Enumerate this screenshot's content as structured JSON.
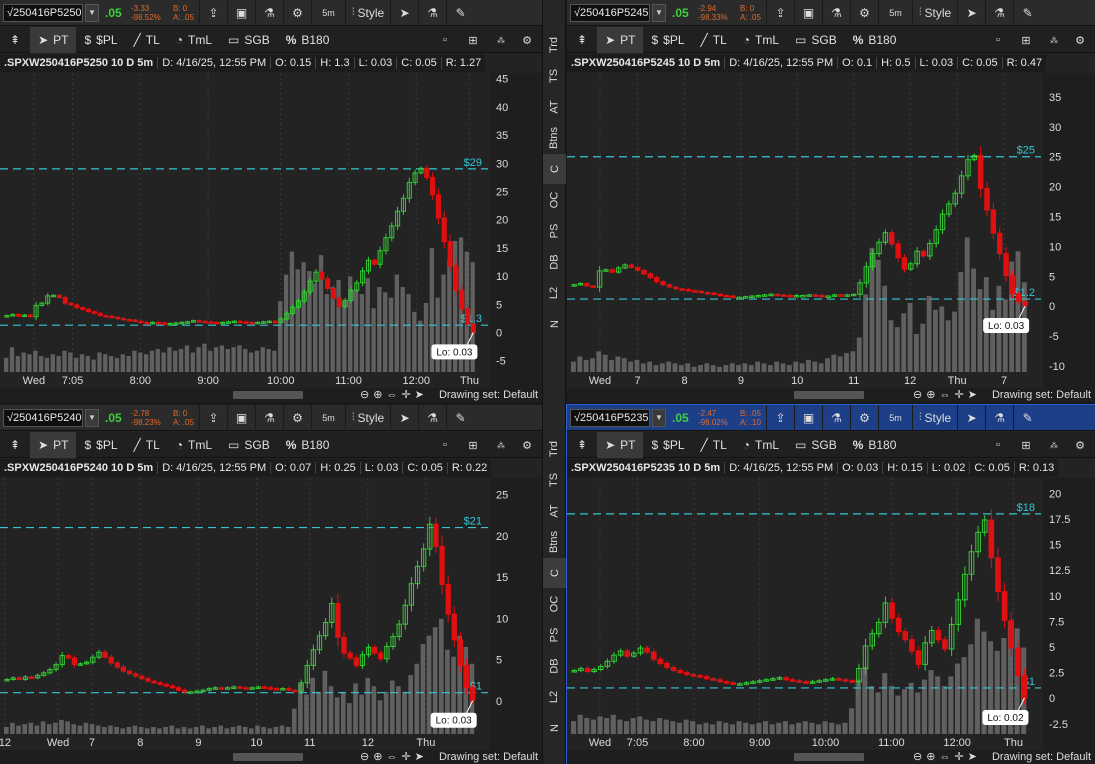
{
  "side_tabs": [
    "Trd",
    "TS",
    "AT",
    "Btns",
    "C",
    "OC",
    "PS",
    "DB",
    "L2",
    "N"
  ],
  "toolbar": {
    "style_label": "Style",
    "timeframe_label": "5m",
    "pt_label": "PT",
    "pl_label": "$PL",
    "tl_label": "TL",
    "tml_label": "TmL",
    "sgb_label": "SGB",
    "b180_label": "B180",
    "drawing_set": "Drawing set: Default"
  },
  "colors": {
    "up": "#33cc33",
    "down": "#e01010",
    "level": "#35c6d6",
    "volume": "#6b6b6b",
    "active_header": "#1d3f87"
  },
  "panels": [
    {
      "id": "p5250",
      "symbol_short": "√250416P5250",
      "last": ".05",
      "change": "-3.33",
      "change_pct": "-98.52%",
      "bid": "B: 0",
      "ask": "A: .05",
      "active": false,
      "info": {
        "symbol": ".SPXW250416P5250 10 D 5m",
        "date": "D: 4/16/25, 12:55 PM",
        "open": "O: 0.15",
        "high": "H: 1.3",
        "low": "L: 0.03",
        "close": "C: 0.05",
        "range": "R: 1.27"
      },
      "lo_label": "Lo: 0.03",
      "x_labels": [
        {
          "t": "Wed",
          "p": 0.07
        },
        {
          "t": "7:05",
          "p": 0.15
        },
        {
          "t": "8:00",
          "p": 0.29
        },
        {
          "t": "9:00",
          "p": 0.43
        },
        {
          "t": "10:00",
          "p": 0.58
        },
        {
          "t": "11:00",
          "p": 0.72
        },
        {
          "t": "12:00",
          "p": 0.86
        },
        {
          "t": "Thu",
          "p": 0.97
        }
      ],
      "chart_data": {
        "type": "candlestick",
        "ylim": [
          -7,
          46
        ],
        "y_ticks": [
          45,
          40,
          35,
          30,
          25,
          20,
          15,
          10,
          5,
          0,
          -5
        ],
        "levels": [
          {
            "value": 29,
            "label": "$29"
          },
          {
            "value": 1.3,
            "label": "$1.3"
          }
        ],
        "low_value": 0.03,
        "closes": [
          3,
          3.2,
          2.9,
          3.1,
          2.8,
          4.8,
          5.2,
          6.5,
          6.6,
          6.2,
          5.2,
          4.9,
          4.4,
          4.1,
          3.7,
          3.4,
          3.0,
          2.9,
          2.7,
          2.5,
          2.3,
          2.2,
          2.0,
          1.8,
          1.7,
          1.8,
          1.7,
          1.5,
          1.6,
          1.7,
          1.8,
          1.9,
          2.1,
          2.0,
          1.9,
          1.8,
          1.7,
          1.8,
          1.9,
          2.0,
          1.9,
          1.8,
          1.7,
          1.8,
          1.9,
          2.0,
          1.8,
          2.4,
          3.4,
          4.5,
          5.6,
          7.2,
          9.1,
          10.7,
          9.5,
          7.8,
          6.1,
          4.6,
          5.7,
          7.5,
          8.8,
          10.9,
          12.8,
          12.1,
          14.5,
          16.8,
          18.9,
          21.5,
          23.8,
          26.6,
          28.3,
          29.1,
          27.5,
          24.4,
          20.3,
          16.1,
          11.8,
          7.5,
          4.2,
          1.5,
          0.05
        ],
        "volumes": [
          8,
          14,
          9,
          11,
          10,
          12,
          9,
          8,
          10,
          9,
          12,
          11,
          8,
          10,
          9,
          7,
          11,
          10,
          9,
          8,
          10,
          9,
          12,
          11,
          10,
          12,
          13,
          11,
          14,
          12,
          13,
          15,
          11,
          14,
          16,
          12,
          14,
          15,
          13,
          14,
          15,
          13,
          11,
          12,
          14,
          13,
          12,
          40,
          55,
          68,
          58,
          62,
          57,
          50,
          66,
          44,
          48,
          52,
          40,
          54,
          46,
          44,
          53,
          36,
          48,
          45,
          42,
          55,
          48,
          44,
          34,
          29,
          39,
          70,
          42,
          55,
          64,
          74,
          76,
          68,
          62
        ]
      }
    },
    {
      "id": "p5245",
      "symbol_short": "√250416P5245",
      "last": ".05",
      "change": "-2.94",
      "change_pct": "-98.33%",
      "bid": "B: 0",
      "ask": "A: .05",
      "active": false,
      "info": {
        "symbol": ".SPXW250416P5245 10 D 5m",
        "date": "D: 4/16/25, 12:55 PM",
        "open": "O: 0.1",
        "high": "H: 0.5",
        "low": "L: 0.03",
        "close": "C: 0.05",
        "range": "R: 0.47"
      },
      "lo_label": "Lo: 0.03",
      "x_labels": [
        {
          "t": "Wed",
          "p": 0.07
        },
        {
          "t": "7",
          "p": 0.15
        },
        {
          "t": "8",
          "p": 0.25
        },
        {
          "t": "9",
          "p": 0.37
        },
        {
          "t": "10",
          "p": 0.49
        },
        {
          "t": "11",
          "p": 0.61
        },
        {
          "t": "12",
          "p": 0.73
        },
        {
          "t": "Thu",
          "p": 0.83
        },
        {
          "t": "7",
          "p": 0.93
        }
      ],
      "chart_data": {
        "type": "candlestick",
        "ylim": [
          -11,
          39
        ],
        "y_ticks": [
          35,
          30,
          25,
          20,
          15,
          10,
          5,
          0,
          -5,
          -10
        ],
        "levels": [
          {
            "value": 25,
            "label": "$25"
          },
          {
            "value": 1.2,
            "label": "$1.2"
          }
        ],
        "low_value": 0.03,
        "closes": [
          3.6,
          3.8,
          3.4,
          3.2,
          5.9,
          6.1,
          5.7,
          6.4,
          6.9,
          6.5,
          6.0,
          5.4,
          4.8,
          4.1,
          3.6,
          3.2,
          2.9,
          2.8,
          2.6,
          2.5,
          2.3,
          2.2,
          2.0,
          1.8,
          1.7,
          1.5,
          1.5,
          1.6,
          1.7,
          1.8,
          1.9,
          2.0,
          1.9,
          1.8,
          1.7,
          1.8,
          1.8,
          1.9,
          1.8,
          1.7,
          1.7,
          1.9,
          1.8,
          1.9,
          2.0,
          3.9,
          6.6,
          8.8,
          10.7,
          12.3,
          10.4,
          8.1,
          6.2,
          7.1,
          9.2,
          8.4,
          10.5,
          12.8,
          15.4,
          17.1,
          18.9,
          21.8,
          24.5,
          25.2,
          19.7,
          16.1,
          12.2,
          8.8,
          5.1,
          2.1,
          0.8,
          0.05
        ],
        "volumes": [
          6,
          9,
          7,
          8,
          12,
          10,
          7,
          9,
          8,
          6,
          7,
          5,
          6,
          4,
          5,
          6,
          5,
          4,
          5,
          3,
          4,
          5,
          4,
          3,
          4,
          5,
          4,
          5,
          4,
          6,
          5,
          4,
          6,
          5,
          4,
          6,
          5,
          7,
          6,
          5,
          8,
          10,
          9,
          11,
          12,
          20,
          45,
          72,
          65,
          50,
          30,
          26,
          34,
          40,
          22,
          28,
          44,
          36,
          38,
          30,
          35,
          58,
          78,
          60,
          48,
          55,
          36,
          50,
          42,
          64,
          70,
          52
        ]
      }
    },
    {
      "id": "p5240",
      "symbol_short": "√250416P5240",
      "last": ".05",
      "change": "-2.78",
      "change_pct": "-98.23%",
      "bid": "B: 0",
      "ask": "A: .05",
      "active": false,
      "info": {
        "symbol": ".SPXW250416P5240 10 D 5m",
        "date": "D: 4/16/25, 12:55 PM",
        "open": "O: 0.07",
        "high": "H: 0.25",
        "low": "L: 0.03",
        "close": "C: 0.05",
        "range": "R: 0.22"
      },
      "lo_label": "Lo: 0.03",
      "x_labels": [
        {
          "t": "12",
          "p": 0.01
        },
        {
          "t": "Wed",
          "p": 0.12
        },
        {
          "t": "7",
          "p": 0.19
        },
        {
          "t": "8",
          "p": 0.29
        },
        {
          "t": "9",
          "p": 0.41
        },
        {
          "t": "10",
          "p": 0.53
        },
        {
          "t": "11",
          "p": 0.64
        },
        {
          "t": "12",
          "p": 0.76
        },
        {
          "t": "Thu",
          "p": 0.88
        }
      ],
      "chart_data": {
        "type": "candlestick",
        "ylim": [
          -4,
          27
        ],
        "y_ticks": [
          25,
          20,
          15,
          10,
          5,
          0
        ],
        "levels": [
          {
            "value": 21,
            "label": "$21"
          },
          {
            "value": 1,
            "label": "$1"
          }
        ],
        "low_value": 0.03,
        "closes": [
          2.6,
          2.8,
          2.6,
          2.9,
          2.8,
          3.1,
          3.4,
          3.8,
          4.4,
          5.5,
          5.2,
          4.4,
          4.5,
          4.7,
          5.3,
          5.9,
          5.3,
          4.6,
          4.1,
          3.6,
          3.3,
          3.0,
          2.7,
          2.4,
          2.2,
          2.0,
          1.8,
          1.6,
          1.3,
          1.1,
          1.1,
          1.2,
          1.3,
          1.5,
          1.6,
          1.5,
          1.6,
          1.7,
          1.6,
          1.5,
          1.6,
          1.7,
          1.6,
          1.5,
          1.4,
          1.5,
          1.3,
          1.2,
          2.2,
          4.3,
          6.2,
          7.9,
          9.5,
          11.8,
          7.7,
          5.8,
          5.2,
          4.3,
          5.6,
          6.5,
          5.8,
          5.1,
          6.6,
          7.8,
          9.3,
          11.6,
          14.2,
          16.3,
          18.4,
          21.4,
          18.7,
          14.1,
          10.5,
          7.4,
          4.3,
          1.6,
          0.05
        ],
        "volumes": [
          5,
          8,
          6,
          7,
          8,
          6,
          9,
          7,
          8,
          10,
          9,
          7,
          6,
          8,
          7,
          6,
          5,
          6,
          5,
          4,
          5,
          6,
          5,
          4,
          5,
          4,
          5,
          6,
          4,
          5,
          4,
          5,
          6,
          4,
          5,
          6,
          4,
          5,
          6,
          5,
          4,
          6,
          5,
          4,
          5,
          6,
          5,
          18,
          36,
          28,
          40,
          30,
          45,
          34,
          26,
          30,
          22,
          36,
          28,
          40,
          34,
          24,
          30,
          38,
          34,
          30,
          42,
          50,
          64,
          70,
          76,
          82,
          60,
          55,
          70,
          62,
          50
        ]
      }
    },
    {
      "id": "p5235",
      "symbol_short": "√250416P5235",
      "last": ".05",
      "change": "-2.47",
      "change_pct": "-98.02%",
      "bid": "B: .05",
      "ask": "A: .10",
      "active": true,
      "info": {
        "symbol": ".SPXW250416P5235 10 D 5m",
        "date": "D: 4/16/25, 12:55 PM",
        "open": "O: 0.03",
        "high": "H: 0.15",
        "low": "L: 0.02",
        "close": "C: 0.05",
        "range": "R: 0.13"
      },
      "lo_label": "Lo: 0.02",
      "x_labels": [
        {
          "t": "Wed",
          "p": 0.07
        },
        {
          "t": "7:05",
          "p": 0.15
        },
        {
          "t": "8:00",
          "p": 0.27
        },
        {
          "t": "9:00",
          "p": 0.41
        },
        {
          "t": "10:00",
          "p": 0.55
        },
        {
          "t": "11:00",
          "p": 0.69
        },
        {
          "t": "12:00",
          "p": 0.83
        },
        {
          "t": "Thu",
          "p": 0.95
        }
      ],
      "chart_data": {
        "type": "candlestick",
        "ylim": [
          -3.5,
          21.5
        ],
        "y_ticks": [
          20,
          17.5,
          15,
          12.5,
          10,
          7.5,
          5,
          2.5,
          0,
          -2.5
        ],
        "levels": [
          {
            "value": 18,
            "label": "$18"
          },
          {
            "value": 1,
            "label": "$1"
          }
        ],
        "low_value": 0.02,
        "closes": [
          2.7,
          2.9,
          2.6,
          2.8,
          3.1,
          3.6,
          4.2,
          4.6,
          4.1,
          4.4,
          4.9,
          4.5,
          3.8,
          3.4,
          3.0,
          2.7,
          2.5,
          2.3,
          2.2,
          2.1,
          1.9,
          1.8,
          1.6,
          1.5,
          1.4,
          1.4,
          1.5,
          1.6,
          1.7,
          1.8,
          1.9,
          2.0,
          1.8,
          1.7,
          1.6,
          1.5,
          1.6,
          1.7,
          1.8,
          1.9,
          1.8,
          1.7,
          1.6,
          2.9,
          5.1,
          6.3,
          7.4,
          9.3,
          7.8,
          6.5,
          5.7,
          4.6,
          3.3,
          5.4,
          6.6,
          5.7,
          4.8,
          7.2,
          9.6,
          12.1,
          14.3,
          16.2,
          17.4,
          13.7,
          10.4,
          7.6,
          4.9,
          2.2,
          0.02
        ],
        "volumes": [
          8,
          12,
          10,
          9,
          11,
          10,
          12,
          9,
          8,
          10,
          11,
          9,
          8,
          10,
          9,
          8,
          7,
          9,
          8,
          6,
          7,
          6,
          8,
          7,
          6,
          8,
          7,
          6,
          7,
          8,
          6,
          7,
          8,
          6,
          7,
          8,
          7,
          6,
          8,
          7,
          6,
          7,
          16,
          34,
          42,
          30,
          26,
          38,
          30,
          24,
          28,
          32,
          26,
          34,
          40,
          36,
          30,
          36,
          44,
          48,
          56,
          72,
          64,
          58,
          52,
          60,
          70,
          66,
          54
        ]
      }
    }
  ]
}
